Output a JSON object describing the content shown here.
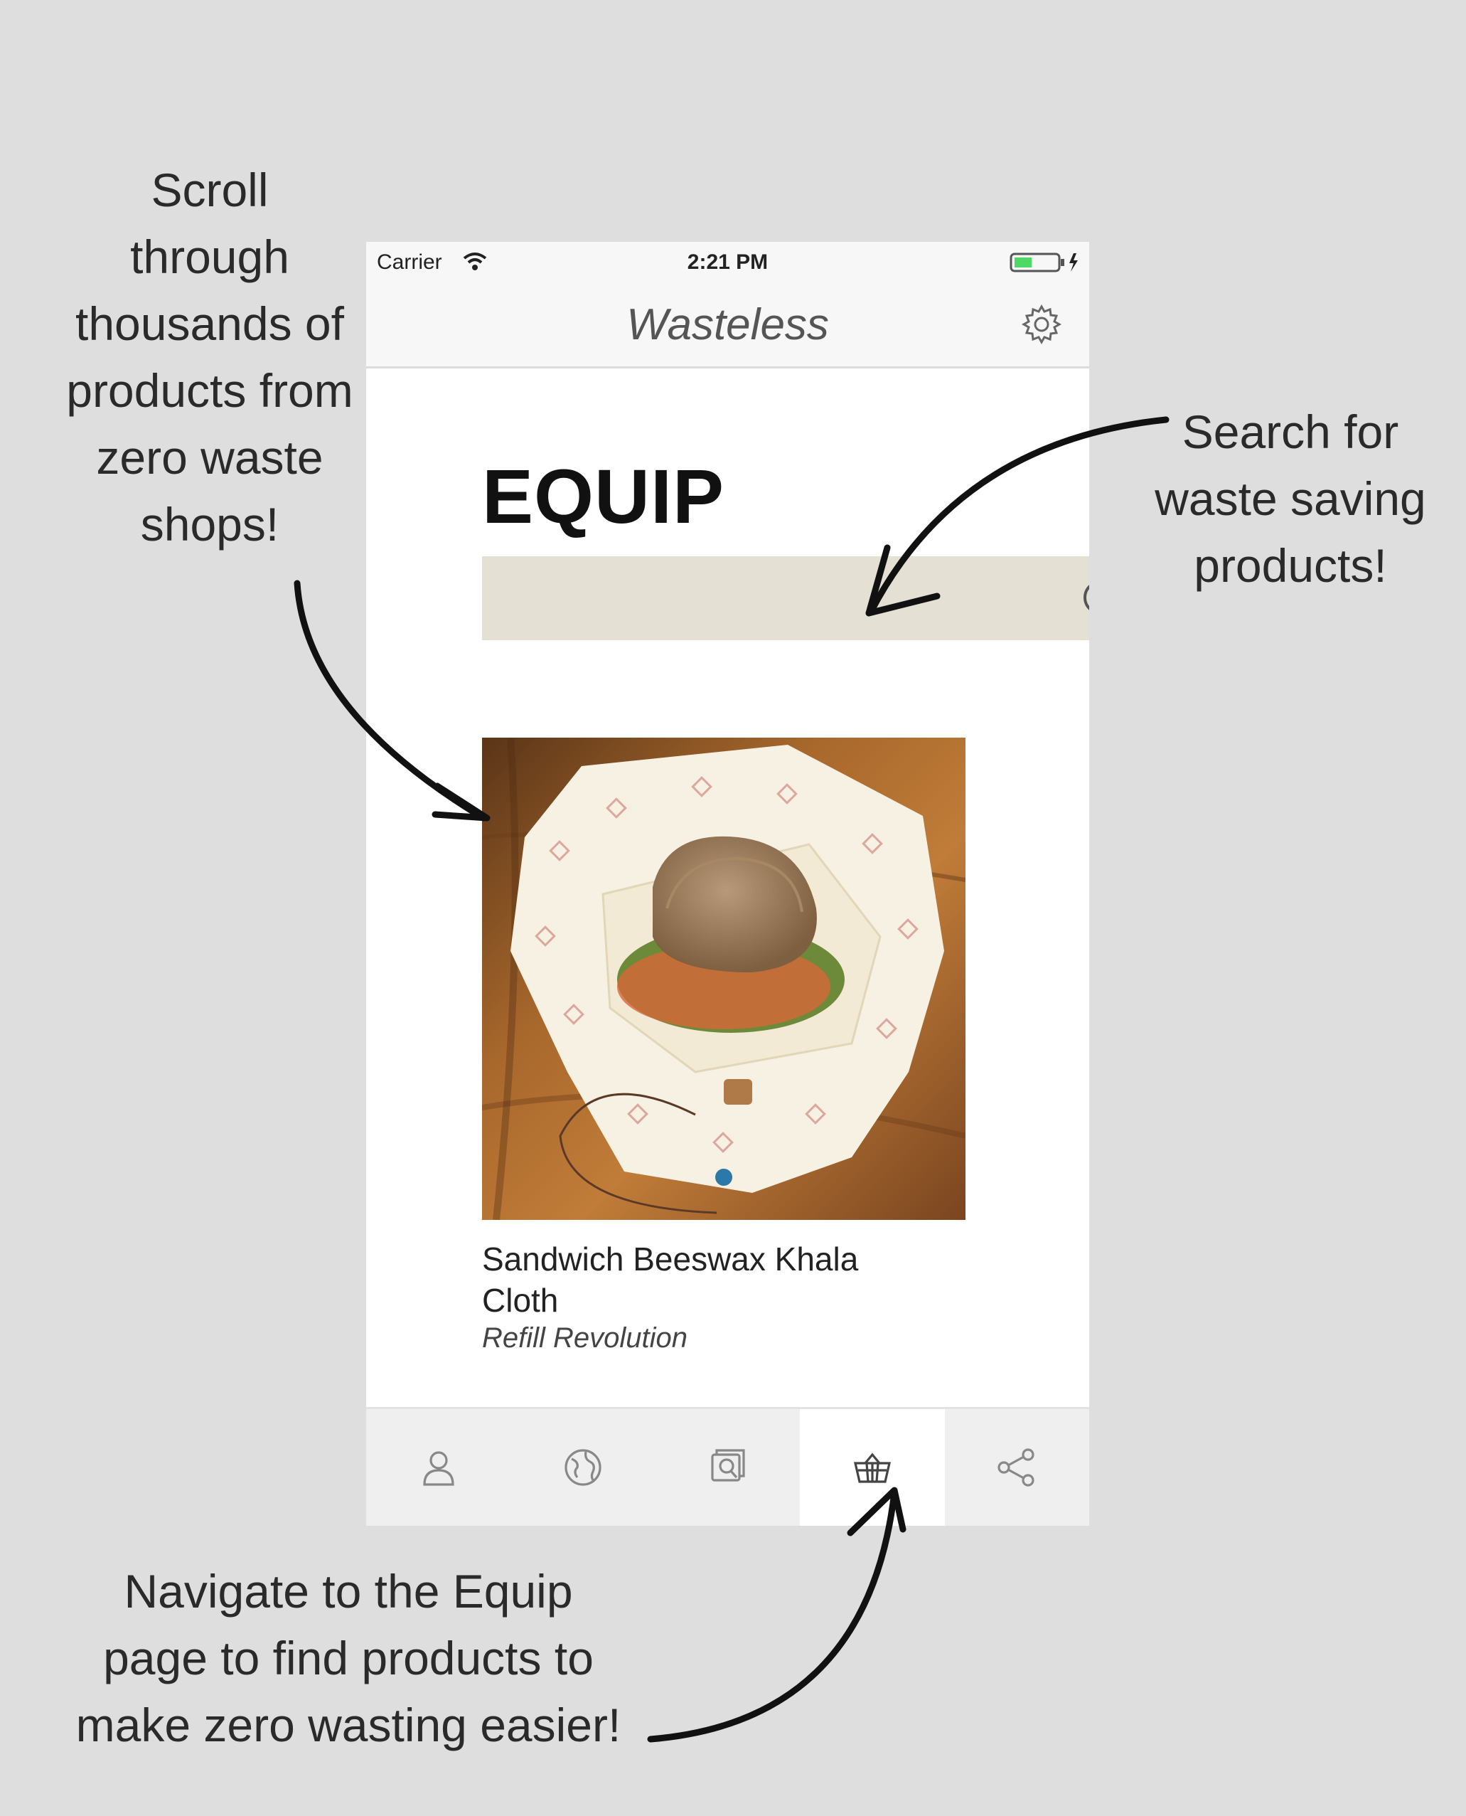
{
  "callouts": {
    "scroll": [
      "Scroll",
      "through",
      "thousands of",
      "products from",
      "zero waste",
      "shops!"
    ],
    "search": [
      "Search for",
      "waste saving",
      "products!"
    ],
    "nav": [
      "Navigate to the Equip",
      "page to find products to",
      "make zero wasting easier!"
    ]
  },
  "status_bar": {
    "carrier": "Carrier",
    "time": "2:21 PM"
  },
  "app": {
    "title": "Wasteless"
  },
  "page": {
    "heading": "EQUIP"
  },
  "search": {
    "placeholder": ""
  },
  "product": {
    "name_line1": "Sandwich Beeswax Khala",
    "name_line2": "Cloth",
    "shop": "Refill Revolution"
  },
  "tabs": [
    {
      "icon": "person-icon"
    },
    {
      "icon": "globe-icon"
    },
    {
      "icon": "photo-search-icon"
    },
    {
      "icon": "basket-icon",
      "active": true
    },
    {
      "icon": "share-icon"
    }
  ]
}
